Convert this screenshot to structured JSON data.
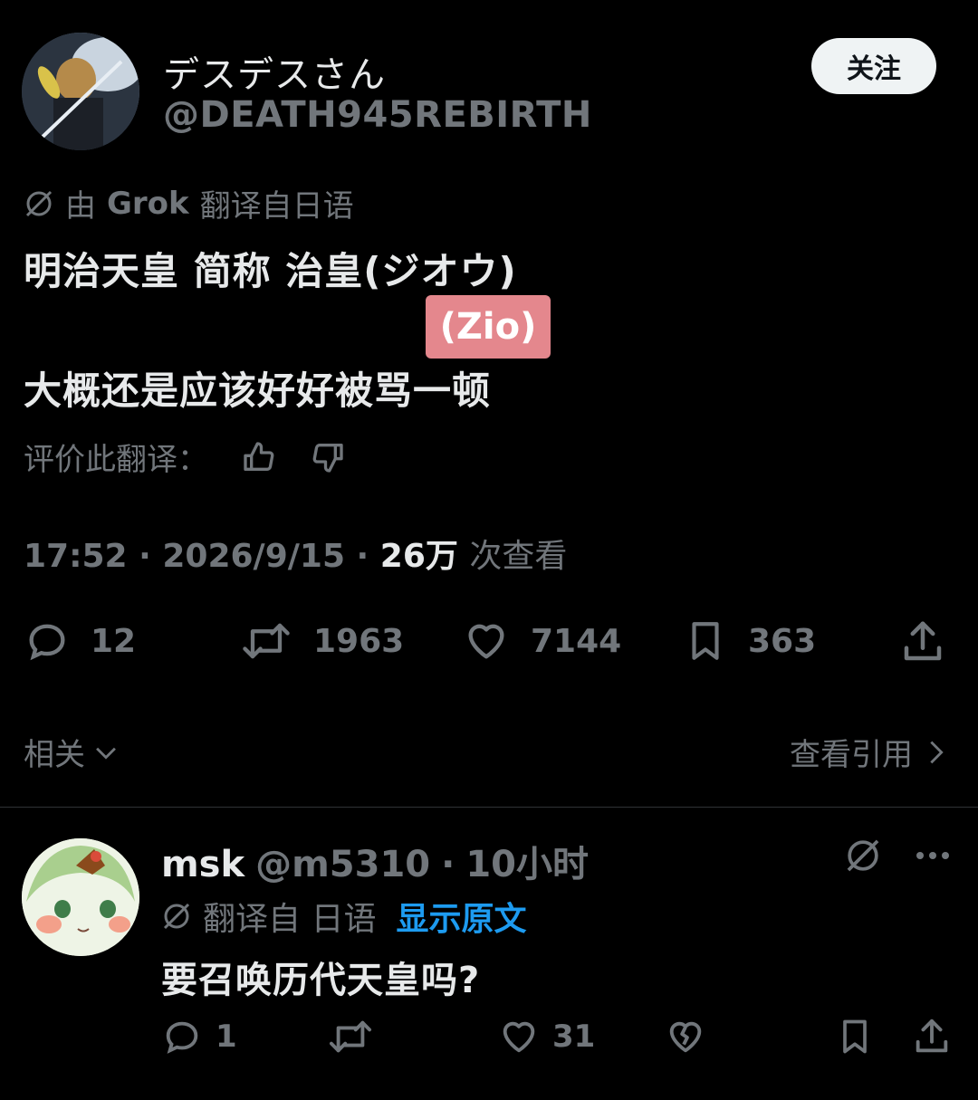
{
  "header": {
    "display_name": "デスデスさん",
    "handle": "@DEATH945REBIRTH",
    "follow_label": "关注",
    "avatar_icon": "profile-photo"
  },
  "translation": {
    "prefix": "由",
    "provider": "Grok",
    "suffix": "翻译自日语",
    "icon": "grok-icon"
  },
  "tweet": {
    "line1": "明治天皇 简称 治皇(ジオウ)",
    "tag": "(Zio)",
    "line2": "大概还是应该好好被骂一顿"
  },
  "rate": {
    "label": "评价此翻译：",
    "up_icon": "thumbs-up-icon",
    "down_icon": "thumbs-down-icon"
  },
  "meta": {
    "time": "17:52",
    "date": "2026/9/15",
    "view_count": "26万",
    "views_label": "次查看"
  },
  "actions": {
    "replies": "12",
    "retweets": "1963",
    "likes": "7144",
    "bookmarks": "363"
  },
  "related": {
    "label": "相关",
    "quotes_label": "查看引用"
  },
  "reply": {
    "name": "msk",
    "handle": "@m5310",
    "time": "10小时",
    "translated_label": "翻译自 日语",
    "show_original": "显示原文",
    "text": "要召唤历代天皇吗?",
    "replies": "1",
    "likes": "31"
  },
  "colors": {
    "background": "#000000",
    "text": "#e7e9ea",
    "muted": "#71767b",
    "link": "#1d9bf0",
    "tag": "#e4878d"
  }
}
